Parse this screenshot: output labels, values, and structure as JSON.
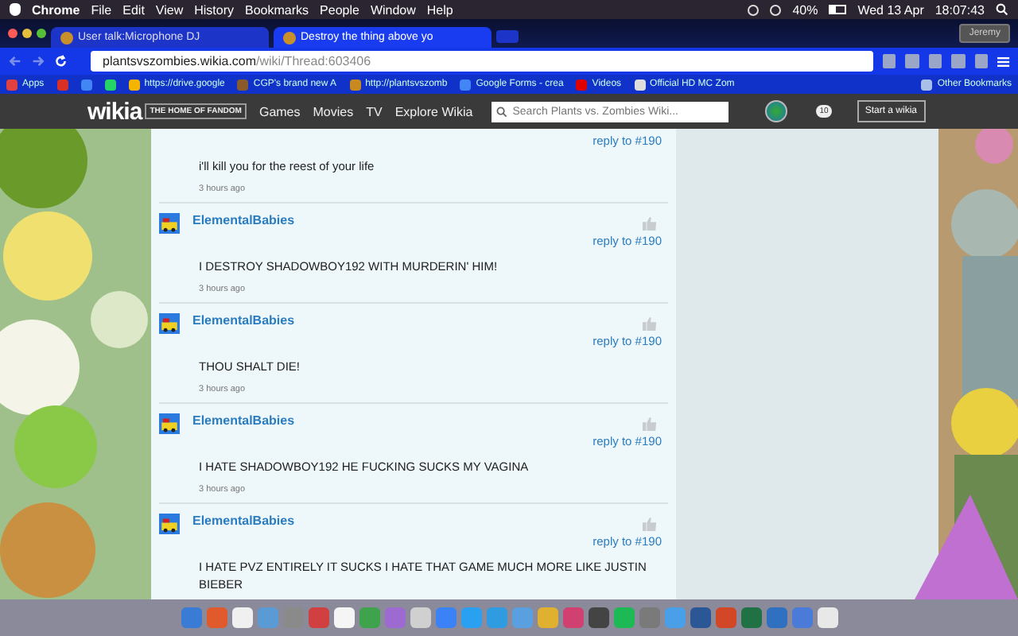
{
  "menu_bar": {
    "app": "Chrome",
    "items": [
      "File",
      "Edit",
      "View",
      "History",
      "Bookmarks",
      "People",
      "Window",
      "Help"
    ],
    "battery": "40%",
    "date": "Wed 13 Apr",
    "time": "18:07:43"
  },
  "tabs": [
    {
      "label": "User talk:Microphone DJ",
      "selected": false
    },
    {
      "label": "Destroy the thing above yo",
      "selected": true
    }
  ],
  "profile": "Jeremy",
  "address": {
    "host": "plantsvszombies.wikia.com",
    "path": "/wiki/Thread:603406"
  },
  "bookmarks": [
    {
      "label": "Apps",
      "kind": "apps"
    },
    {
      "kind": "gmail"
    },
    {
      "kind": "google"
    },
    {
      "kind": "whatsapp"
    },
    {
      "label": "https://drive.google",
      "kind": "drive"
    },
    {
      "label": "CGP's brand new A",
      "kind": "site"
    },
    {
      "label": "http://plantsvszomb",
      "kind": "pvz"
    },
    {
      "label": "Google Forms - crea",
      "kind": "google"
    },
    {
      "label": "Videos",
      "kind": "youtube"
    },
    {
      "label": "Official HD MC Zom",
      "kind": "page"
    }
  ],
  "other_bookmarks": "Other Bookmarks",
  "wikia": {
    "logo": "wikia",
    "tagline": "THE HOME OF FANDOM",
    "nav": [
      "Games",
      "Movies",
      "TV",
      "Explore Wikia"
    ],
    "search_placeholder": "Search Plants vs. Zombies Wiki...",
    "notifications": "10",
    "start_button": "Start a wikia"
  },
  "comments_start": [
    {
      "reply": "reply to #190",
      "text": "i'll kill you for the reest of your life",
      "time": "3 hours ago"
    },
    {
      "user": "ElementalBabies",
      "reply": "reply to #190",
      "text": "I DESTROY SHADOWBOY192 WITH MURDERIN' HIM!",
      "time": "3 hours ago"
    },
    {
      "user": "ElementalBabies",
      "reply": "reply to #190",
      "text": "THOU SHALT DIE!",
      "time": "3 hours ago"
    },
    {
      "user": "ElementalBabies",
      "reply": "reply to #190",
      "text": "I HATE SHADOWBOY192 HE FUCKING SUCKS MY VAGINA",
      "time": "3 hours ago"
    },
    {
      "user": "ElementalBabies",
      "reply": "reply to #190",
      "text": "I HATE PVZ ENTIRELY IT SUCKS I HATE THAT GAME MUCH MORE LIKE JUSTIN BIEBER"
    }
  ]
}
